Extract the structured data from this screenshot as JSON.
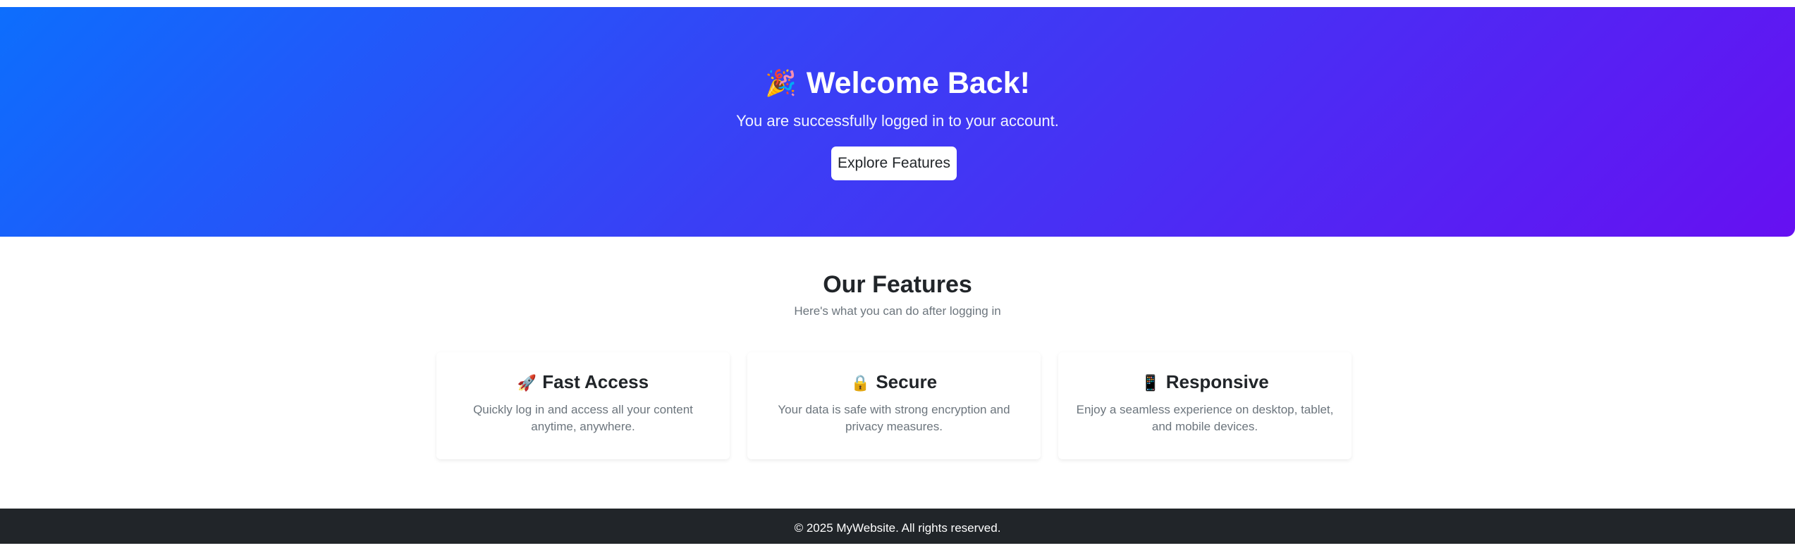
{
  "hero": {
    "icon": "party-popper-icon",
    "emoji": "🎉",
    "title": "Welcome Back!",
    "subtitle": "You are successfully logged in to your account.",
    "button_label": "Explore Features"
  },
  "features": {
    "title": "Our Features",
    "subtitle": "Here's what you can do after logging in",
    "cards": [
      {
        "icon": "rocket-icon",
        "emoji": "🚀",
        "title": "Fast Access",
        "text": "Quickly log in and access all your content anytime, anywhere."
      },
      {
        "icon": "lock-icon",
        "emoji": "🔒",
        "title": "Secure",
        "text": "Your data is safe with strong encryption and privacy measures."
      },
      {
        "icon": "mobile-phone-icon",
        "emoji": "📱",
        "title": "Responsive",
        "text": "Enjoy a seamless experience on desktop, tablet, and mobile devices."
      }
    ]
  },
  "footer": {
    "text": "© 2025 MyWebsite. All rights reserved."
  },
  "colors": {
    "hero_gradient_start": "#0d6efd",
    "hero_gradient_end": "#6610f2",
    "footer_background": "#212529",
    "muted_text": "#6c757d"
  }
}
